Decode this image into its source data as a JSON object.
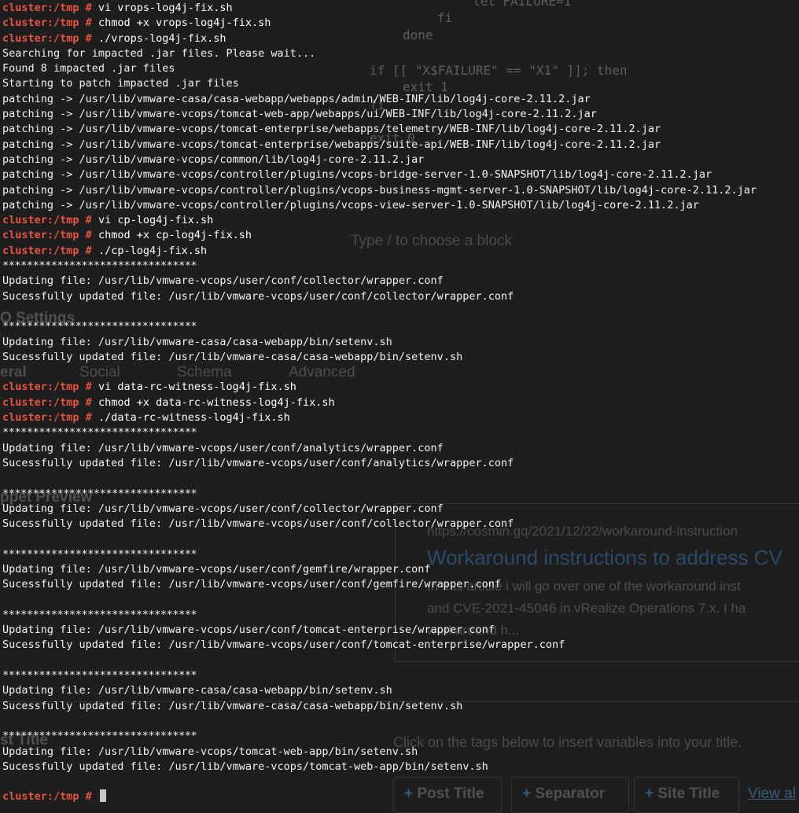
{
  "terminal": {
    "prompt": "cluster:/tmp #",
    "lines": [
      {
        "kind": "partial",
        "text": "cluster:/tmp # vi vrops-log4j-fix.sh"
      },
      {
        "kind": "cmd",
        "text": "chmod +x vrops-log4j-fix.sh"
      },
      {
        "kind": "cmd",
        "text": "./vrops-log4j-fix.sh"
      },
      {
        "kind": "out",
        "text": "Searching for impacted .jar files. Please wait..."
      },
      {
        "kind": "out",
        "text": "Found 8 impacted .jar files"
      },
      {
        "kind": "out",
        "text": "Starting to patch impacted .jar files"
      },
      {
        "kind": "out",
        "text": "patching -> /usr/lib/vmware-casa/casa-webapp/webapps/admin/WEB-INF/lib/log4j-core-2.11.2.jar"
      },
      {
        "kind": "out",
        "text": "patching -> /usr/lib/vmware-vcops/tomcat-web-app/webapps/ui/WEB-INF/lib/log4j-core-2.11.2.jar"
      },
      {
        "kind": "out",
        "text": "patching -> /usr/lib/vmware-vcops/tomcat-enterprise/webapps/telemetry/WEB-INF/lib/log4j-core-2.11.2.jar"
      },
      {
        "kind": "out",
        "text": "patching -> /usr/lib/vmware-vcops/tomcat-enterprise/webapps/suite-api/WEB-INF/lib/log4j-core-2.11.2.jar"
      },
      {
        "kind": "out",
        "text": "patching -> /usr/lib/vmware-vcops/common/lib/log4j-core-2.11.2.jar"
      },
      {
        "kind": "out",
        "text": "patching -> /usr/lib/vmware-vcops/controller/plugins/vcops-bridge-server-1.0-SNAPSHOT/lib/log4j-core-2.11.2.jar"
      },
      {
        "kind": "out",
        "text": "patching -> /usr/lib/vmware-vcops/controller/plugins/vcops-business-mgmt-server-1.0-SNAPSHOT/lib/log4j-core-2.11.2.jar"
      },
      {
        "kind": "out",
        "text": "patching -> /usr/lib/vmware-vcops/controller/plugins/vcops-view-server-1.0-SNAPSHOT/lib/log4j-core-2.11.2.jar"
      },
      {
        "kind": "cmd",
        "text": "vi cp-log4j-fix.sh"
      },
      {
        "kind": "cmd",
        "text": "chmod +x cp-log4j-fix.sh"
      },
      {
        "kind": "cmd",
        "text": "./cp-log4j-fix.sh"
      },
      {
        "kind": "stars",
        "text": "********************************"
      },
      {
        "kind": "out",
        "text": "Updating file: /usr/lib/vmware-vcops/user/conf/collector/wrapper.conf"
      },
      {
        "kind": "out",
        "text": "Sucessfully updated file: /usr/lib/vmware-vcops/user/conf/collector/wrapper.conf"
      },
      {
        "kind": "blank",
        "text": ""
      },
      {
        "kind": "stars",
        "text": "********************************"
      },
      {
        "kind": "out",
        "text": "Updating file: /usr/lib/vmware-casa/casa-webapp/bin/setenv.sh"
      },
      {
        "kind": "out",
        "text": "Sucessfully updated file: /usr/lib/vmware-casa/casa-webapp/bin/setenv.sh"
      },
      {
        "kind": "blank",
        "text": ""
      },
      {
        "kind": "cmd",
        "text": "vi data-rc-witness-log4j-fix.sh"
      },
      {
        "kind": "cmd",
        "text": "chmod +x data-rc-witness-log4j-fix.sh"
      },
      {
        "kind": "cmd",
        "text": "./data-rc-witness-log4j-fix.sh"
      },
      {
        "kind": "stars",
        "text": "********************************"
      },
      {
        "kind": "out",
        "text": "Updating file: /usr/lib/vmware-vcops/user/conf/analytics/wrapper.conf"
      },
      {
        "kind": "out",
        "text": "Sucessfully updated file: /usr/lib/vmware-vcops/user/conf/analytics/wrapper.conf"
      },
      {
        "kind": "blank",
        "text": ""
      },
      {
        "kind": "stars",
        "text": "********************************"
      },
      {
        "kind": "out",
        "text": "Updating file: /usr/lib/vmware-vcops/user/conf/collector/wrapper.conf"
      },
      {
        "kind": "out",
        "text": "Sucessfully updated file: /usr/lib/vmware-vcops/user/conf/collector/wrapper.conf"
      },
      {
        "kind": "blank",
        "text": ""
      },
      {
        "kind": "stars",
        "text": "********************************"
      },
      {
        "kind": "out",
        "text": "Updating file: /usr/lib/vmware-vcops/user/conf/gemfire/wrapper.conf"
      },
      {
        "kind": "out",
        "text": "Sucessfully updated file: /usr/lib/vmware-vcops/user/conf/gemfire/wrapper.conf"
      },
      {
        "kind": "blank",
        "text": ""
      },
      {
        "kind": "stars",
        "text": "********************************"
      },
      {
        "kind": "out",
        "text": "Updating file: /usr/lib/vmware-vcops/user/conf/tomcat-enterprise/wrapper.conf"
      },
      {
        "kind": "out",
        "text": "Sucessfully updated file: /usr/lib/vmware-vcops/user/conf/tomcat-enterprise/wrapper.conf"
      },
      {
        "kind": "blank",
        "text": ""
      },
      {
        "kind": "stars",
        "text": "********************************"
      },
      {
        "kind": "out",
        "text": "Updating file: /usr/lib/vmware-casa/casa-webapp/bin/setenv.sh"
      },
      {
        "kind": "out",
        "text": "Sucessfully updated file: /usr/lib/vmware-casa/casa-webapp/bin/setenv.sh"
      },
      {
        "kind": "blank",
        "text": ""
      },
      {
        "kind": "stars",
        "text": "********************************"
      },
      {
        "kind": "out",
        "text": "Updating file: /usr/lib/vmware-vcops/tomcat-web-app/bin/setenv.sh"
      },
      {
        "kind": "out",
        "text": "Sucessfully updated file: /usr/lib/vmware-vcops/tomcat-web-app/bin/setenv.sh"
      },
      {
        "kind": "blank",
        "text": ""
      },
      {
        "kind": "input",
        "text": ""
      }
    ]
  },
  "background": {
    "code": {
      "line1": "let FAILURE=1",
      "line2": "fi",
      "line3": "done",
      "line4": "if [[ \"X$FAILURE\" == \"X1\" ]]; then",
      "line5": "exit 1",
      "line6": "fi",
      "line7": "exit 0"
    },
    "editor_placeholder": "Type / to choose a block",
    "settings_heading": "O Settings",
    "tabs": [
      "eral",
      "Social",
      "Schema",
      "Advanced"
    ],
    "snippet_heading": "ppet Preview",
    "snippet": {
      "url": "https://cosmin.gq/2021/12/22/workaround-instruction",
      "title": "Workaround instructions to address CV",
      "desc_line1": "In this article i will go over one of the workaround inst",
      "desc_line2": "and CVE-2021-45046 in vRealize Operations 7.x. I ha",
      "desc_line3": "workaround h..."
    },
    "post_title_heading": "st Title",
    "tags_hint": "Click on the tags below to insert variables into your title.",
    "tags": [
      "Post Title",
      "Separator",
      "Site Title"
    ],
    "view_all": "View al"
  },
  "colors": {
    "prompt": "#e8543f",
    "terminal_text": "#f2f2f2",
    "terminal_bg": "#1e1e1e"
  }
}
